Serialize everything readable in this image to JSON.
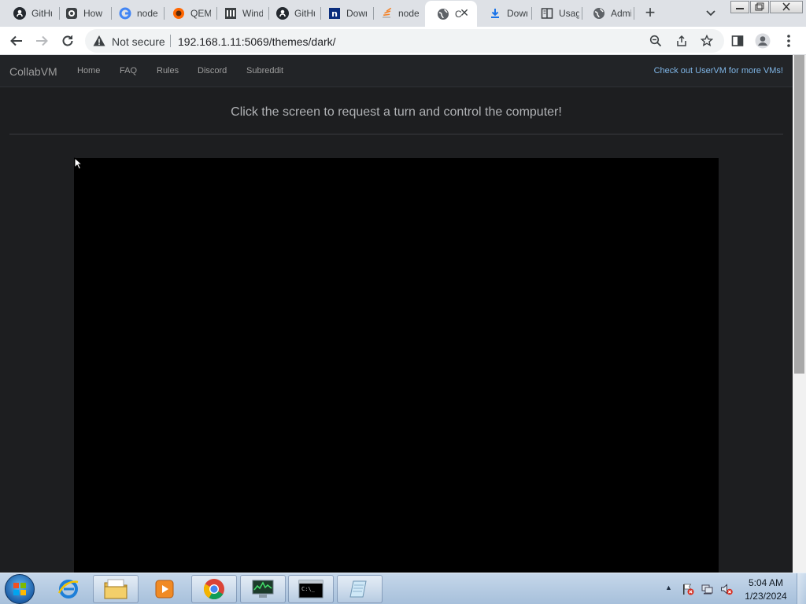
{
  "browser": {
    "tabs": [
      {
        "label": "GitHub",
        "icon": "github-icon"
      },
      {
        "label": "How",
        "icon": "how-icon"
      },
      {
        "label": "node",
        "icon": "google-icon"
      },
      {
        "label": "QEMU",
        "icon": "qemu-icon"
      },
      {
        "label": "Windows",
        "icon": "bank-icon"
      },
      {
        "label": "GitHub",
        "icon": "github-icon"
      },
      {
        "label": "Download",
        "icon": "n-icon"
      },
      {
        "label": "node",
        "icon": "stack-icon"
      },
      {
        "label": "C",
        "icon": "globe-icon",
        "active": true
      },
      {
        "label": "Download",
        "icon": "download-icon"
      },
      {
        "label": "Usage",
        "icon": "book-icon"
      },
      {
        "label": "Admin",
        "icon": "globe-icon"
      }
    ],
    "tab_close": "✕",
    "new_tab": "+",
    "security_label": "Not secure",
    "url": "192.168.1.11:5069/themes/dark/"
  },
  "page": {
    "brand": "CollabVM",
    "nav_links": [
      "Home",
      "FAQ",
      "Rules",
      "Discord",
      "Subreddit"
    ],
    "uservm_link": "Check out UserVM for more VMs!",
    "turn_message": "Click the screen to request a turn and control the computer!"
  },
  "taskbar": {
    "apps": [
      "internet-explorer",
      "windows-explorer",
      "media-player",
      "chrome",
      "task-manager",
      "command-prompt",
      "notepad"
    ],
    "clock_time": "5:04 AM",
    "clock_date": "1/23/2024",
    "tray_arrow": "▲"
  },
  "colors": {
    "page_bg": "#1d1e20",
    "navbar_bg": "#222427",
    "link_accent": "#7fb5e6",
    "taskbar": "#b6cce4"
  }
}
